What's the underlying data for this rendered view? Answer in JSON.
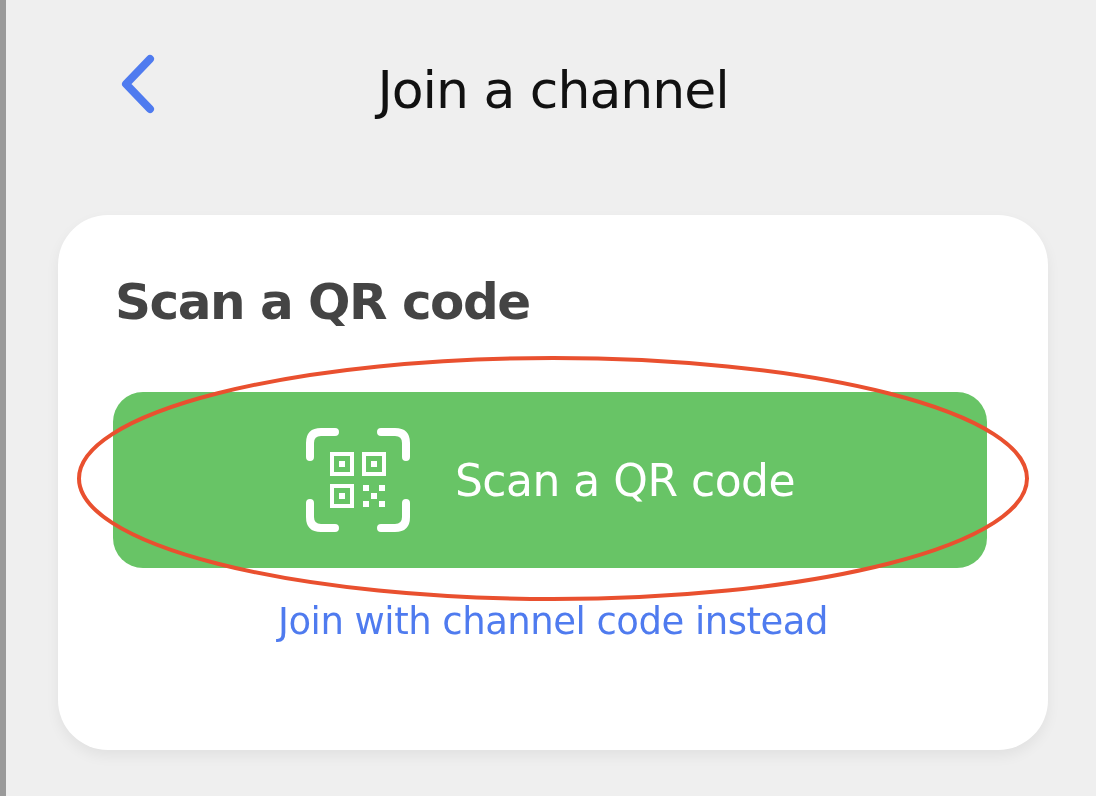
{
  "header": {
    "title": "Join a channel"
  },
  "card": {
    "heading": "Scan a QR code",
    "scan_button": {
      "label": "Scan a QR code",
      "highlighted": true
    },
    "link": "Join with channel code instead"
  }
}
